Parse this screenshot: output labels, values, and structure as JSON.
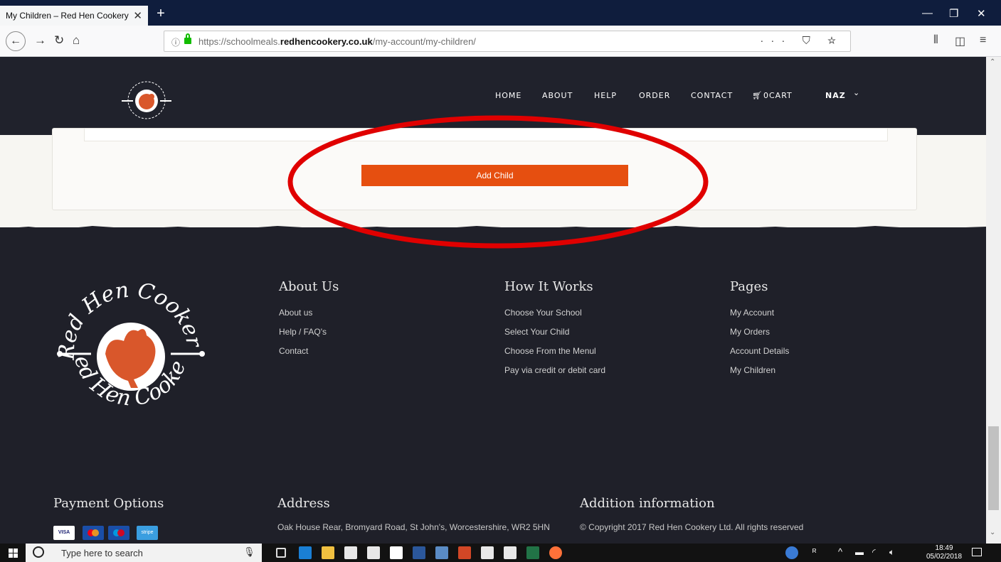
{
  "browser": {
    "tab_title": "My Children – Red Hen Cookery",
    "tab_close": "✕",
    "new_tab": "+",
    "url_prefix": "https://schoolmeals.",
    "url_domain": "redhencookery.co.uk",
    "url_path": "/my-account/my-children/",
    "url_actions": "··· ⛉ ☆",
    "window_minimize": "—",
    "window_restore": "❐",
    "window_close": "✕"
  },
  "nav": {
    "items": [
      "HOME",
      "ABOUT",
      "HELP",
      "ORDER",
      "CONTACT"
    ],
    "cart_label": "0CART",
    "user": "NAZ",
    "user_chevron": "⌄"
  },
  "content": {
    "add_child_label": "Add Child"
  },
  "footer": {
    "about": {
      "title": "About Us",
      "links": [
        "About us",
        "Help / FAQ's",
        "Contact"
      ]
    },
    "how": {
      "title": "How It Works",
      "links": [
        "Choose Your School",
        "Select Your Child",
        "Choose From the Menul",
        "Pay via credit or debit card"
      ]
    },
    "pages": {
      "title": "Pages",
      "links": [
        "My Account",
        "My Orders",
        "Account Details",
        "My Children"
      ]
    },
    "payment": {
      "title": "Payment Options",
      "cards": [
        "VISA",
        "",
        "",
        "stripe"
      ]
    },
    "address": {
      "title": "Address",
      "text": "Oak House Rear, Bromyard Road, St John's, Worcestershire, WR2 5HN"
    },
    "info": {
      "title": "Addition information",
      "text": "© Copyright 2017 Red Hen Cookery Ltd. All rights reserved"
    },
    "logo_text_top": "Red Hen Cookery",
    "logo_text_bottom": "Red Hen Cookery"
  },
  "taskbar": {
    "search_placeholder": "Type here to search",
    "time": "18:49",
    "date": "05/02/2018"
  },
  "colors": {
    "accent": "#e64f10",
    "header_bg": "#20222c",
    "footer_bg": "#1f2029"
  }
}
